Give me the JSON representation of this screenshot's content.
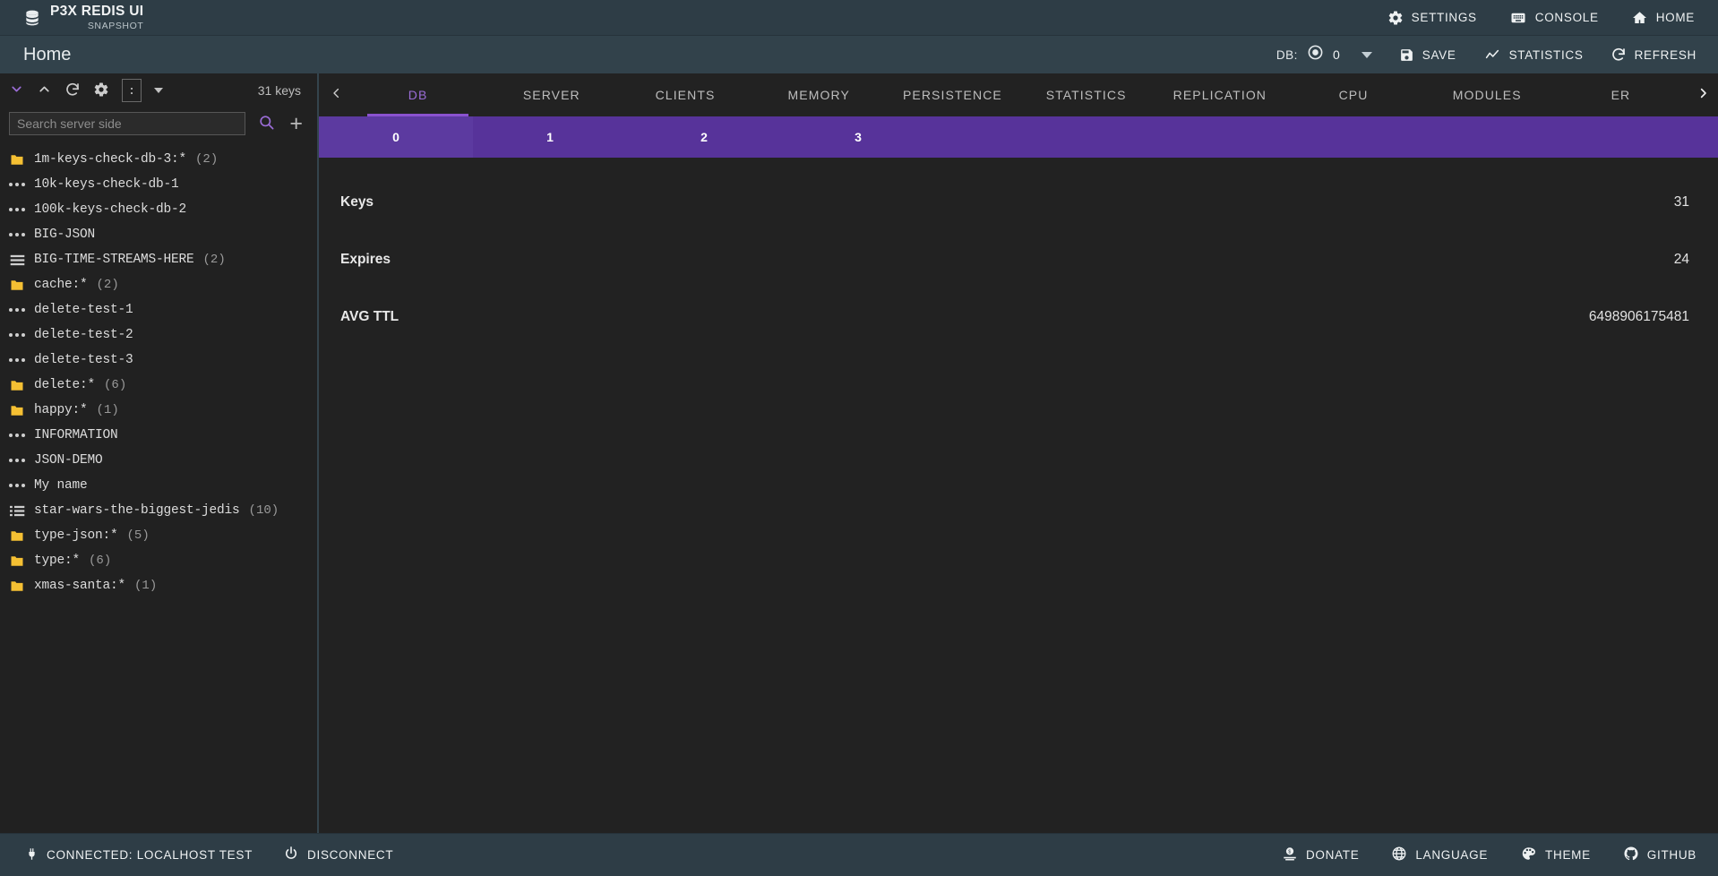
{
  "colors": {
    "header_bg": "#2e3d46",
    "titlebar_bg": "#32424b",
    "body_bg": "#222222",
    "accent_purple": "#57339a",
    "accent_purple_text": "#9b6dd7",
    "folder_yellow": "#f5c033"
  },
  "header": {
    "brand_title": "P3X REDIS UI",
    "brand_subtitle": "SNAPSHOT",
    "brand_icon": "database-icon",
    "actions": [
      {
        "label": "SETTINGS",
        "icon": "gear-icon",
        "name": "settings-button"
      },
      {
        "label": "CONSOLE",
        "icon": "keyboard-icon",
        "name": "console-button"
      },
      {
        "label": "HOME",
        "icon": "home-icon",
        "name": "home-button"
      }
    ]
  },
  "titlebar": {
    "title": "Home",
    "db_label": "DB:",
    "db_value": "0",
    "db_icon": "radio-selected-icon",
    "dropdown_icon": "chevron-down-icon",
    "actions": [
      {
        "label": "SAVE",
        "icon": "save-icon",
        "name": "save-button"
      },
      {
        "label": "STATISTICS",
        "icon": "chart-line-icon",
        "name": "statistics-button"
      },
      {
        "label": "REFRESH",
        "icon": "refresh-icon",
        "name": "refresh-button"
      }
    ]
  },
  "sidebar": {
    "toolbar": {
      "collapse_all_icon": "chevron-down-icon",
      "expand_all_icon": "chevron-up-icon",
      "reload_icon": "refresh-icon",
      "settings_icon": "gear-icon",
      "separator_value": ":",
      "separator_dropdown_icon": "caret-down-icon",
      "key_count": "31 keys"
    },
    "search": {
      "placeholder": "Search server side",
      "value": "",
      "search_icon": "search-icon",
      "add_icon": "plus-icon"
    },
    "tree": [
      {
        "label": "1m-keys-check-db-3:*",
        "count": "(2)",
        "icon": "folder-icon"
      },
      {
        "label": "10k-keys-check-db-1",
        "count": "",
        "icon": "string-icon"
      },
      {
        "label": "100k-keys-check-db-2",
        "count": "",
        "icon": "string-icon"
      },
      {
        "label": "BIG-JSON",
        "count": "",
        "icon": "string-icon"
      },
      {
        "label": "BIG-TIME-STREAMS-HERE",
        "count": "(2)",
        "icon": "stream-icon"
      },
      {
        "label": "cache:*",
        "count": "(2)",
        "icon": "folder-icon"
      },
      {
        "label": "delete-test-1",
        "count": "",
        "icon": "string-icon"
      },
      {
        "label": "delete-test-2",
        "count": "",
        "icon": "string-icon"
      },
      {
        "label": "delete-test-3",
        "count": "",
        "icon": "string-icon"
      },
      {
        "label": "delete:*",
        "count": "(6)",
        "icon": "folder-icon"
      },
      {
        "label": "happy:*",
        "count": "(1)",
        "icon": "folder-icon"
      },
      {
        "label": "INFORMATION",
        "count": "",
        "icon": "string-icon"
      },
      {
        "label": "JSON-DEMO",
        "count": "",
        "icon": "string-icon"
      },
      {
        "label": "My name",
        "count": "",
        "icon": "string-icon"
      },
      {
        "label": "star-wars-the-biggest-jedis",
        "count": "(10)",
        "icon": "list-icon"
      },
      {
        "label": "type-json:*",
        "count": "(5)",
        "icon": "folder-icon"
      },
      {
        "label": "type:*",
        "count": "(6)",
        "icon": "folder-icon"
      },
      {
        "label": "xmas-santa:*",
        "count": "(1)",
        "icon": "folder-icon"
      }
    ]
  },
  "main": {
    "tabs_prev_icon": "chevron-left-icon",
    "tabs_next_icon": "chevron-right-icon",
    "tabs": [
      {
        "label": "DB",
        "active": true
      },
      {
        "label": "SERVER",
        "active": false
      },
      {
        "label": "CLIENTS",
        "active": false
      },
      {
        "label": "MEMORY",
        "active": false
      },
      {
        "label": "PERSISTENCE",
        "active": false
      },
      {
        "label": "STATISTICS",
        "active": false
      },
      {
        "label": "REPLICATION",
        "active": false
      },
      {
        "label": "CPU",
        "active": false
      },
      {
        "label": "MODULES",
        "active": false
      },
      {
        "label": "ER",
        "active": false
      }
    ],
    "db_strip": [
      {
        "label": "0",
        "active": true
      },
      {
        "label": "1",
        "active": false
      },
      {
        "label": "2",
        "active": false
      },
      {
        "label": "3",
        "active": false
      }
    ],
    "stats": [
      {
        "key": "Keys",
        "value": "31"
      },
      {
        "key": "Expires",
        "value": "24"
      },
      {
        "key": "AVG TTL",
        "value": "6498906175481"
      }
    ]
  },
  "footer": {
    "left": [
      {
        "label": "CONNECTED: LOCALHOST TEST",
        "icon": "plug-icon",
        "name": "connection-status"
      },
      {
        "label": "DISCONNECT",
        "icon": "power-icon",
        "name": "disconnect-button"
      }
    ],
    "right": [
      {
        "label": "DONATE",
        "icon": "donate-icon",
        "name": "donate-button"
      },
      {
        "label": "LANGUAGE",
        "icon": "globe-icon",
        "name": "language-button"
      },
      {
        "label": "THEME",
        "icon": "palette-icon",
        "name": "theme-button"
      },
      {
        "label": "GITHUB",
        "icon": "github-icon",
        "name": "github-button"
      }
    ]
  }
}
